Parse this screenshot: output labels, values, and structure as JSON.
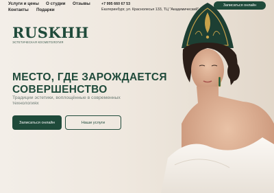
{
  "nav": {
    "services": "Услуги и цены",
    "about": "О студии",
    "reviews": "Отзывы",
    "contacts": "Контакты",
    "gifts": "Подарки"
  },
  "contact": {
    "phone": "+7 995 660 67 53",
    "address": "Екатеринбург, ул. Краснолесья 133, ТЦ \"Академический\""
  },
  "top_cta": "Записаться онлайн",
  "logo": {
    "name": "RUSKHH",
    "subtitle": "ЭСТЕТИЧЕСКАЯ КОСМЕТОЛОГИЯ"
  },
  "hero": {
    "headline_line1": "МЕСТО, ГДЕ ЗАРОЖДАЕТСЯ",
    "headline_line2": "СОВЕРШЕНСТВО",
    "subtext": "Традиции эстетики, воплощённые в современных технологиях",
    "primary_button": "Записаться онлайн",
    "secondary_button": "Наши услуги"
  },
  "colors": {
    "brand_green": "#1f4a3a",
    "background": "#f1ebe3",
    "gold": "#c9a24a"
  }
}
